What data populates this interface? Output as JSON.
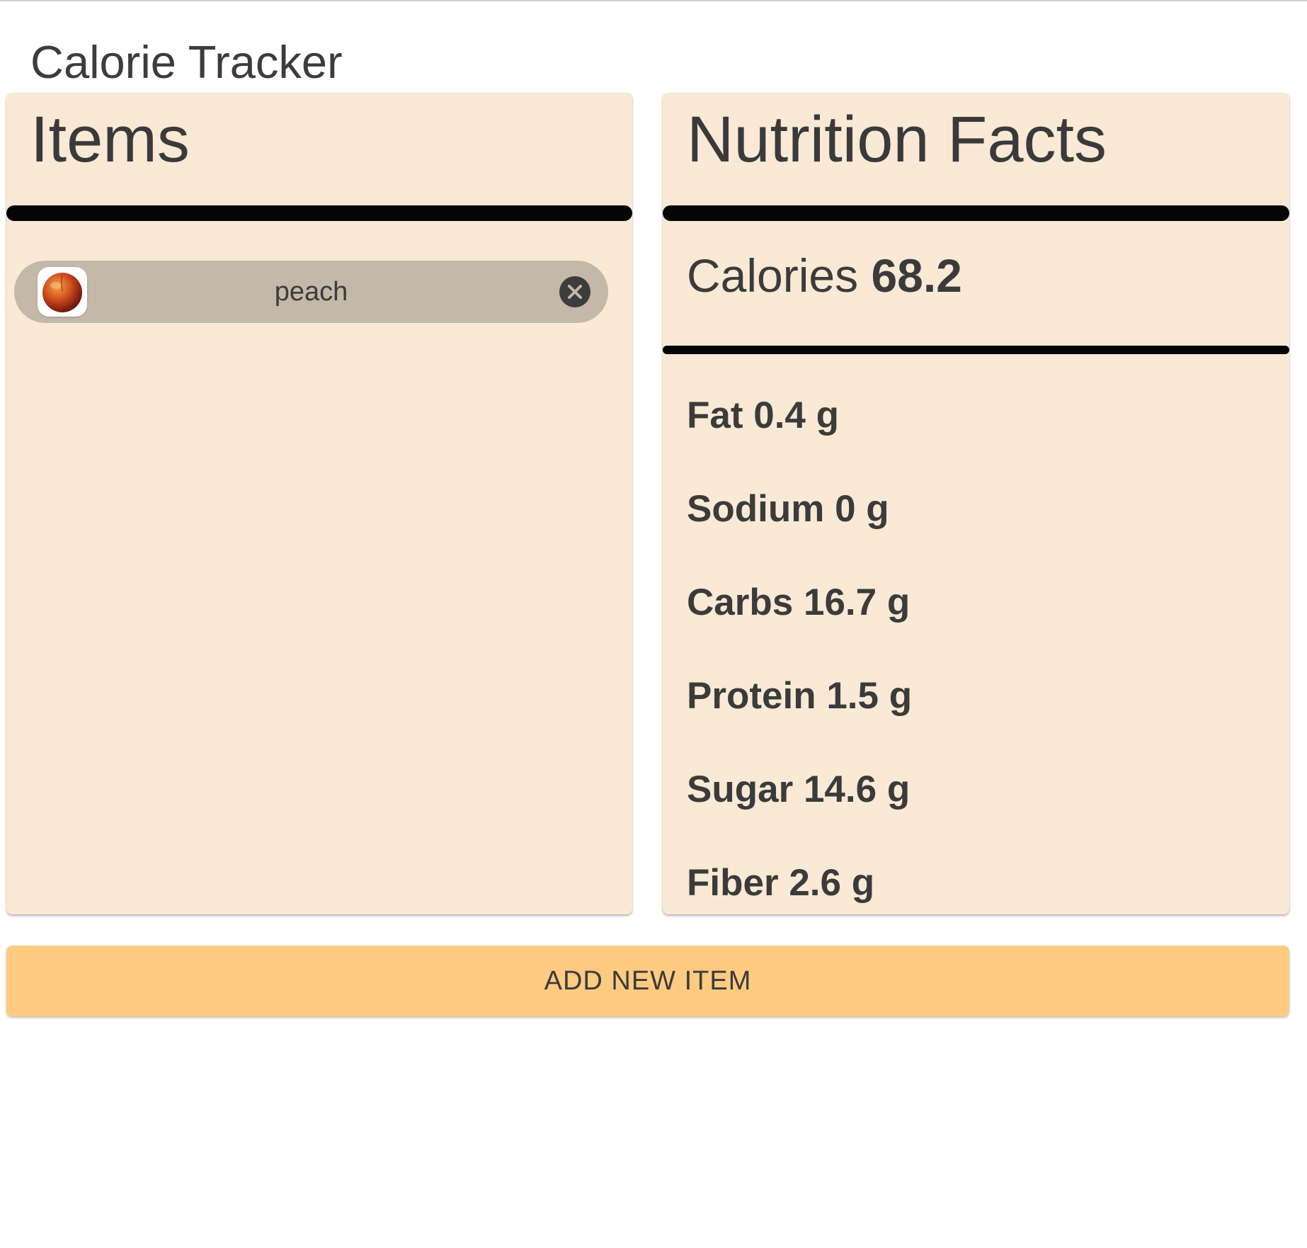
{
  "app": {
    "title": "Calorie Tracker"
  },
  "items_panel": {
    "heading": "Items",
    "items": [
      {
        "name": "peach",
        "avatar_icon": "peach-icon",
        "remove_icon": "close-circle-icon"
      }
    ]
  },
  "nutrition_panel": {
    "heading": "Nutrition Facts",
    "calories": {
      "label": "Calories",
      "value": "68.2"
    },
    "nutrients": [
      {
        "label": "Fat",
        "value": "0.4 g"
      },
      {
        "label": "Sodium",
        "value": "0 g"
      },
      {
        "label": "Carbs",
        "value": "16.7 g"
      },
      {
        "label": "Protein",
        "value": "1.5 g"
      },
      {
        "label": "Sugar",
        "value": "14.6 g"
      },
      {
        "label": "Fiber",
        "value": "2.6 g"
      }
    ]
  },
  "actions": {
    "add_label": "ADD NEW ITEM"
  },
  "colors": {
    "card_background": "#f9e9d5",
    "chip_background": "#c4b8a8",
    "button_background": "#fecb80",
    "rule": "#050505",
    "text": "#3b3b3b"
  }
}
